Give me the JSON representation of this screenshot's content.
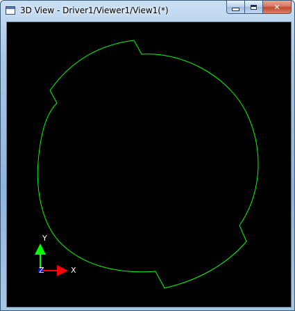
{
  "window": {
    "title": "3D View - Driver1/Viewer1/View1(*)",
    "icon": "app-window-icon"
  },
  "caption_buttons": {
    "minimize": "minimize-icon",
    "maximize": "maximize-icon",
    "close": "close-icon",
    "close_glyph": "✕"
  },
  "viewport": {
    "background": "#000000",
    "shape_color": "#00ff00",
    "shape": "circle with three notched steps"
  },
  "triad": {
    "x_label": "X",
    "y_label": "Y",
    "z_label": "Z",
    "x_color": "#ff0000",
    "y_color": "#00ff00",
    "z_color": "#0000ff"
  }
}
